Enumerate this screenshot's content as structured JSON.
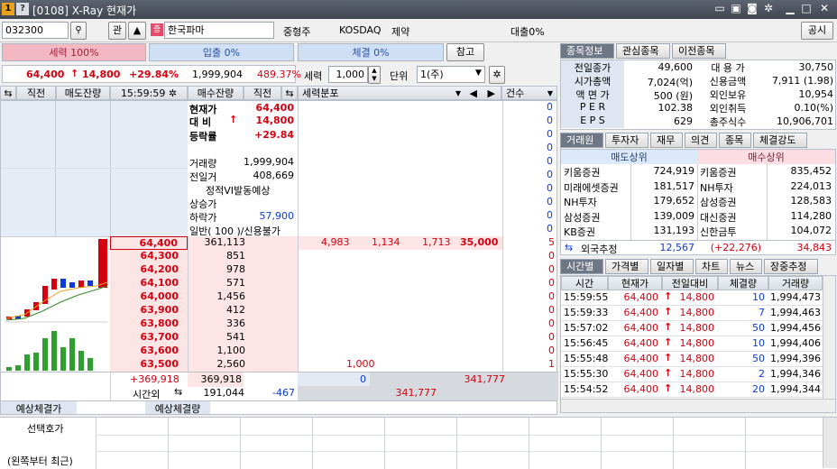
{
  "window": {
    "badge1": "1",
    "badge2": "?",
    "title": "[0108] X-Ray 현재가",
    "ctrl_icons": [
      "window-icon",
      "layout-icon",
      "camera-icon",
      "gear-icon",
      "minimize-icon",
      "maximize-icon",
      "close-icon"
    ]
  },
  "toolbar": {
    "code": "032300",
    "related": "관",
    "market_badge": "증",
    "stock_name": "한국파마",
    "category": "중형주",
    "market": "KOSDAQ",
    "sector": "제약",
    "loan": "대출0%",
    "notice": "공시"
  },
  "bars": {
    "seryeok": "세력 100%",
    "ipchul": "입출 0%",
    "chegyeol": "체결 0%",
    "chamgo": "참고"
  },
  "price_line": {
    "price": "64,400",
    "change_arrow": "↑",
    "change": "14,800",
    "rate": "+29.84%",
    "volume": "1,999,904",
    "ratio": "489.37%"
  },
  "force_ctrl": {
    "label": "세력",
    "value": "1,000",
    "unit_label": "단위",
    "unit_value": "1(주)"
  },
  "orderbook_head": {
    "prev": "직전",
    "sell_rem": "매도잔량",
    "time": "15:59:59",
    "buy_rem": "매수잔량",
    "prev2": "직전",
    "dist": "세력분포",
    "count": "건수"
  },
  "info": {
    "current_label": "현재가",
    "current": "64,400",
    "vs_label": "대 비",
    "vs": "14,800",
    "rate_label": "등락률",
    "rate": "+29.84",
    "vol_label": "거래량",
    "vol": "1,999,904",
    "prevvol_label": "전일거",
    "prevvol": "408,669",
    "vi": "정적VI발동예상",
    "upper_label": "상승가",
    "upper": "",
    "lower_label": "하락가",
    "lower": "57,900",
    "credit": "일반( 100 )/신용불가"
  },
  "asks": [
    {
      "price": "64,400",
      "qty": "361,113",
      "d1": "4,983",
      "d2": "1,134",
      "d3": "1,713",
      "d4": "35,000",
      "cnt": "5"
    },
    {
      "price": "64,300",
      "qty": "851",
      "cnt": "0"
    },
    {
      "price": "64,200",
      "qty": "978",
      "cnt": "0"
    },
    {
      "price": "64,100",
      "qty": "571",
      "cnt": "0"
    },
    {
      "price": "64,000",
      "qty": "1,456",
      "cnt": "0"
    }
  ],
  "bids": [
    {
      "price": "63,900",
      "qty": "412",
      "cnt": "0"
    },
    {
      "price": "63,800",
      "qty": "336",
      "cnt": "0"
    },
    {
      "price": "63,700",
      "qty": "541",
      "cnt": "0"
    },
    {
      "price": "63,600",
      "qty": "1,100",
      "cnt": "0"
    },
    {
      "price": "63,500",
      "qty": "2,560",
      "cnt": "1",
      "d1": "1,000"
    }
  ],
  "upper_counts": [
    "0",
    "0",
    "0",
    "0",
    "0",
    "0",
    "0",
    "0",
    "0",
    "0"
  ],
  "totals": {
    "diff": "+369,918",
    "total": "369,918",
    "after_label": "시간외",
    "after": "191,044",
    "after_chg": "-467",
    "z1": "0",
    "z2": "341,777",
    "z3": "341,777"
  },
  "expect": {
    "price_label": "예상체결가",
    "qty_label": "예상체결량"
  },
  "bottom": {
    "label1": "선택호가",
    "label2": "(왼쪽부터 최근)"
  },
  "right_tabs1": [
    "종목정보",
    "관심종목",
    "이전종목"
  ],
  "stock_info": [
    {
      "l": "전일종가",
      "v": "49,600",
      "l2": "대 용 가",
      "v2": "30,750"
    },
    {
      "l": "시가총액",
      "v": "7,024(억)",
      "l2": "신용금액",
      "v2": "7,911  (1.98)"
    },
    {
      "l": "액 면 가",
      "v": "500 (원)",
      "l2": "외인보유",
      "v2": "10,954"
    },
    {
      "l": "P E R",
      "v": "102.38",
      "l2": "외인취득",
      "v2": "0.10(%)"
    },
    {
      "l": "E P S",
      "v": "629",
      "l2": "총주식수",
      "v2": "10,906,701"
    }
  ],
  "right_tabs2": [
    "거래원",
    "투자자",
    "재무",
    "의견",
    "종목",
    "체결강도"
  ],
  "brokers": {
    "sell_head": "매도상위",
    "buy_head": "매수상위",
    "rows": [
      {
        "s": "키움증권",
        "sv": "724,919",
        "b": "키움증권",
        "bv": "835,452"
      },
      {
        "s": "미래에셋증권",
        "sv": "181,517",
        "b": "NH투자",
        "bv": "224,013"
      },
      {
        "s": "NH투자",
        "sv": "179,652",
        "b": "삼성증권",
        "bv": "128,583"
      },
      {
        "s": "삼성증권",
        "sv": "139,009",
        "b": "대신증권",
        "bv": "114,280"
      },
      {
        "s": "KB증권",
        "sv": "131,193",
        "b": "신한금투",
        "bv": "104,072"
      }
    ],
    "foreign_label": "외국추정",
    "foreign_sell": "12,567",
    "foreign_net": "(+22,276)",
    "foreign_buy": "34,843"
  },
  "right_tabs3": [
    "시간별",
    "가격별",
    "일자별",
    "차트",
    "뉴스",
    "장중추정"
  ],
  "ticks": {
    "headers": [
      "시간",
      "현재가",
      "전일대비",
      "체결량",
      "거래량"
    ],
    "rows": [
      {
        "t": "15:59:55",
        "p": "64,400",
        "c": "14,800",
        "q": "10",
        "v": "1,994,473"
      },
      {
        "t": "15:59:33",
        "p": "64,400",
        "c": "14,800",
        "q": "7",
        "v": "1,994,463"
      },
      {
        "t": "15:57:02",
        "p": "64,400",
        "c": "14,800",
        "q": "50",
        "v": "1,994,456"
      },
      {
        "t": "15:56:45",
        "p": "64,400",
        "c": "14,800",
        "q": "10",
        "v": "1,994,406"
      },
      {
        "t": "15:55:48",
        "p": "64,400",
        "c": "14,800",
        "q": "50",
        "v": "1,994,396"
      },
      {
        "t": "15:55:30",
        "p": "64,400",
        "c": "14,800",
        "q": "2",
        "v": "1,994,346"
      },
      {
        "t": "15:54:52",
        "p": "64,400",
        "c": "14,800",
        "q": "20",
        "v": "1,994,344"
      }
    ]
  },
  "colors": {
    "up": "#d4000f",
    "down": "#0a3bd8",
    "ask_bg": "#dfe9f8",
    "bid_bg": "#fde5e5"
  }
}
